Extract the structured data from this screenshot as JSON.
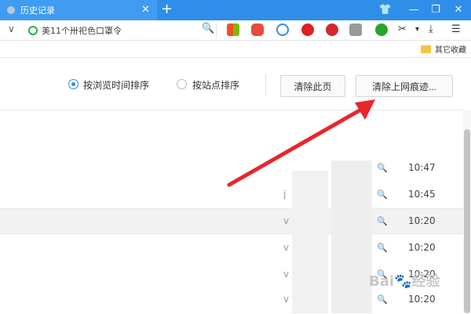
{
  "window": {
    "tab_title": "历史记录",
    "tab_close": "✕",
    "new_tab": "+",
    "controls": {
      "skin": "👕",
      "minimize": "—",
      "restore": "❐",
      "close": "✕"
    }
  },
  "address": {
    "dropdown": "∨",
    "text": "美11个卅祀色口罩令",
    "search_glyph": "🔍"
  },
  "extensions": [
    {
      "name": "apps-icon",
      "color": "#f25022"
    },
    {
      "name": "game-icon",
      "color": "#e84b3c"
    },
    {
      "name": "minus-circle-icon",
      "color": "#2f8ee8"
    },
    {
      "name": "stop-hand-icon",
      "color": "#e02020"
    },
    {
      "name": "abs-icon",
      "color": "#d7262b"
    },
    {
      "name": "triangle-icon",
      "color": "#9a9a9a"
    },
    {
      "name": "eye-icon",
      "color": "#2aa52a"
    }
  ],
  "toolbar_tail": {
    "scissors": "✂",
    "caret": "▾",
    "download": "⤓",
    "menu": "☰"
  },
  "bookmarks": {
    "other": "其它收藏"
  },
  "history": {
    "sort_by_time": "按浏览时间排序",
    "sort_by_site": "按站点排序",
    "clear_page": "清除此页",
    "clear_traces": "清除上网痕迹...",
    "rows": [
      {
        "letter": "",
        "time": "10:47"
      },
      {
        "letter": "j",
        "time": "10:45"
      },
      {
        "letter": "v",
        "time": "10:20"
      },
      {
        "letter": "v",
        "time": "10:20"
      },
      {
        "letter": "v",
        "time": "10:20"
      },
      {
        "letter": "v",
        "time": "10:20"
      }
    ]
  },
  "watermark": "Bai🐾经验"
}
